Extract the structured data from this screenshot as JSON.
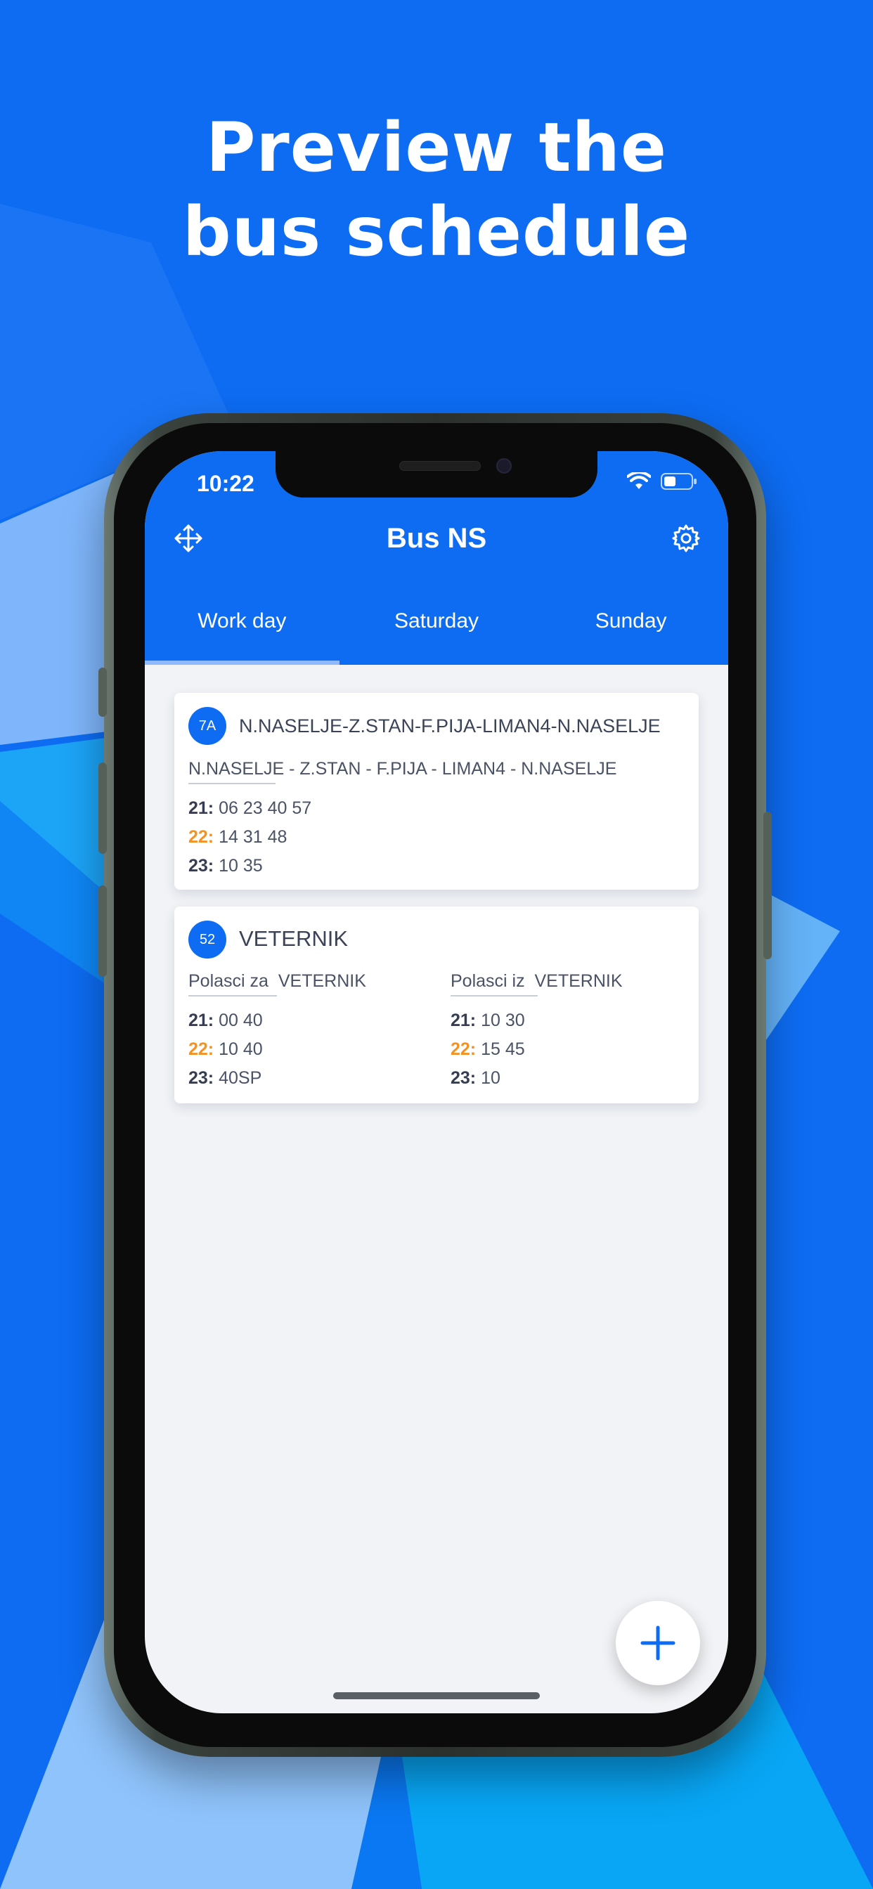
{
  "headline": {
    "line1": "Preview the",
    "line2": "bus schedule"
  },
  "status_bar": {
    "time": "10:22"
  },
  "app_bar": {
    "title": "Bus NS"
  },
  "tabs": [
    {
      "label": "Work day",
      "active": true
    },
    {
      "label": "Saturday",
      "active": false
    },
    {
      "label": "Sunday",
      "active": false
    }
  ],
  "cards": [
    {
      "badge": "7A",
      "title": "N.NASELJE-Z.STAN-F.PIJA-LIMAN4-N.NASELJE",
      "route": "N.NASELJE - Z.STAN - F.PIJA - LIMAN4 - N.NASELJE",
      "times": [
        {
          "hour": "21:",
          "minutes": "06 23 40 57"
        },
        {
          "hour": "22:",
          "minutes": "14 31 48"
        },
        {
          "hour": "23:",
          "minutes": "10 35"
        }
      ]
    },
    {
      "badge": "52",
      "title": "VETERNIK",
      "columns": [
        {
          "label": "Polasci za",
          "dest": "VETERNIK",
          "times": [
            {
              "hour": "21:",
              "minutes": "00 40"
            },
            {
              "hour": "22:",
              "minutes": "10 40"
            },
            {
              "hour": "23:",
              "minutes": "40SP"
            }
          ]
        },
        {
          "label": "Polasci iz",
          "dest": "VETERNIK",
          "times": [
            {
              "hour": "21:",
              "minutes": "10 30"
            },
            {
              "hour": "22:",
              "minutes": "15 45"
            },
            {
              "hour": "23:",
              "minutes": "10"
            }
          ]
        }
      ]
    }
  ],
  "colors": {
    "primary": "#0d6cf2",
    "accent_hour": "#f39323",
    "background": "#f1f3f6"
  },
  "icons": {
    "left_toolbar": "move-arrows-icon",
    "right_toolbar": "gear-icon",
    "fab": "plus-icon"
  }
}
